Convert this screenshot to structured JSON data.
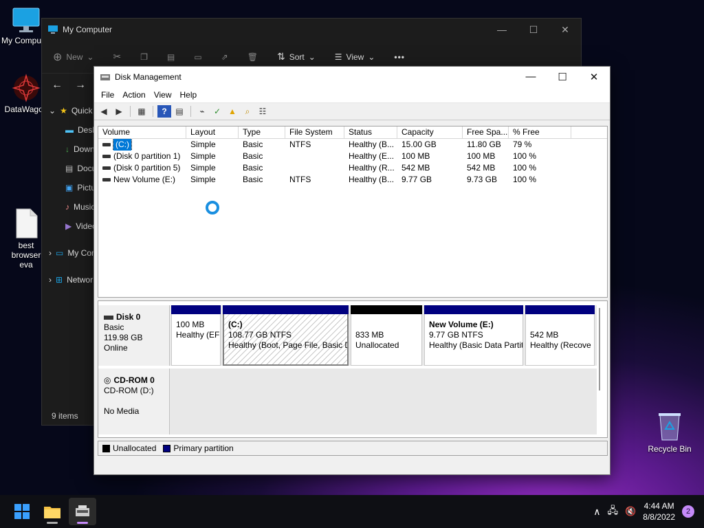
{
  "desktop": {
    "icons": [
      {
        "label": "My Computer",
        "icon": "monitor-icon"
      },
      {
        "label": "DataWagon",
        "icon": "datawagon-icon"
      },
      {
        "label": "best browser eva",
        "icon": "file-icon"
      },
      {
        "label": "Recycle Bin",
        "icon": "recycle-bin-icon"
      }
    ]
  },
  "explorer": {
    "title": "My Computer",
    "toolbar": {
      "new": "New",
      "sort": "Sort",
      "view": "View",
      "more": "•••"
    },
    "tree": [
      {
        "label": "Quick access"
      },
      {
        "label": "Desktop"
      },
      {
        "label": "Downloads"
      },
      {
        "label": "Documents"
      },
      {
        "label": "Pictures"
      },
      {
        "label": "Music"
      },
      {
        "label": "Videos"
      },
      {
        "label": "My Computer"
      },
      {
        "label": "Network"
      }
    ],
    "status": "9 items"
  },
  "dm": {
    "title": "Disk Management",
    "menu": [
      "File",
      "Action",
      "View",
      "Help"
    ],
    "columns": [
      "Volume",
      "Layout",
      "Type",
      "File System",
      "Status",
      "Capacity",
      "Free Spa...",
      "% Free"
    ],
    "rows": [
      [
        "(C:)",
        "Simple",
        "Basic",
        "NTFS",
        "Healthy (B...",
        "15.00 GB",
        "11.80 GB",
        "79 %"
      ],
      [
        "(Disk 0 partition 1)",
        "Simple",
        "Basic",
        "",
        "Healthy (E...",
        "100 MB",
        "100 MB",
        "100 %"
      ],
      [
        "(Disk 0 partition 5)",
        "Simple",
        "Basic",
        "",
        "Healthy (R...",
        "542 MB",
        "542 MB",
        "100 %"
      ],
      [
        "New Volume (E:)",
        "Simple",
        "Basic",
        "NTFS",
        "Healthy (B...",
        "9.77 GB",
        "9.73 GB",
        "100 %"
      ]
    ],
    "disks": {
      "disk0": {
        "name": "Disk 0",
        "type": "Basic",
        "size": "119.98 GB",
        "state": "Online",
        "partitions": [
          {
            "title": "",
            "line1": "100 MB",
            "line2": "Healthy (EF"
          },
          {
            "title": "(C:)",
            "line1": "108.77 GB NTFS",
            "line2": "Healthy (Boot, Page File, Basic D"
          },
          {
            "title": "",
            "line1": "833 MB",
            "line2": "Unallocated"
          },
          {
            "title": "New Volume  (E:)",
            "line1": "9.77 GB NTFS",
            "line2": "Healthy (Basic Data Partit"
          },
          {
            "title": "",
            "line1": "542 MB",
            "line2": "Healthy (Recove"
          }
        ]
      },
      "cdrom0": {
        "name": "CD-ROM 0",
        "drive": "CD-ROM (D:)",
        "media": "No Media"
      }
    },
    "legend": {
      "unallocated": "Unallocated",
      "primary": "Primary partition"
    },
    "colors": {
      "primary": "#00007f",
      "unallocated": "#000000"
    }
  },
  "taskbar": {
    "time": "4:44 AM",
    "date": "8/8/2022",
    "notifications": "2"
  }
}
